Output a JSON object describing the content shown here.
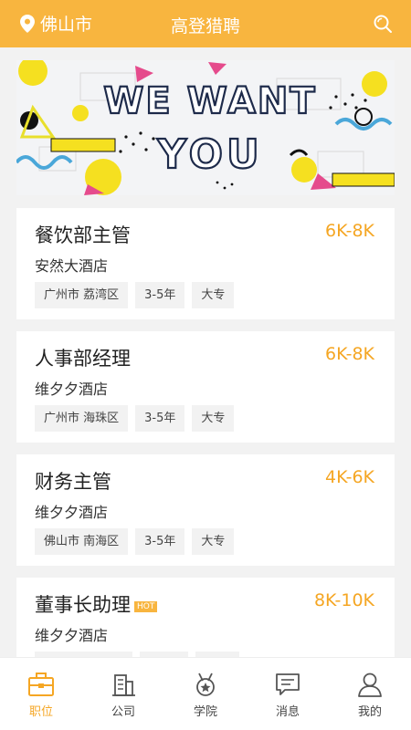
{
  "header": {
    "city": "佛山市",
    "title": "高登猎聘"
  },
  "banner": {
    "line1": "WE WANT",
    "line2": "YOU"
  },
  "jobs": [
    {
      "title": "餐饮部主管",
      "salary": "6K-8K",
      "company": "安然大酒店",
      "location": "广州市 荔湾区",
      "experience": "3-5年",
      "education": "大专",
      "hot": ""
    },
    {
      "title": "人事部经理",
      "salary": "6K-8K",
      "company": "维夕夕酒店",
      "location": "广州市 海珠区",
      "experience": "3-5年",
      "education": "大专",
      "hot": ""
    },
    {
      "title": "财务主管",
      "salary": "4K-6K",
      "company": "维夕夕酒店",
      "location": "佛山市 南海区",
      "experience": "3-5年",
      "education": "大专",
      "hot": ""
    },
    {
      "title": "董事长助理",
      "salary": "8K-10K",
      "company": "维夕夕酒店",
      "location": "",
      "experience": "",
      "education": "",
      "hot": "HOT"
    }
  ],
  "tabbar": {
    "items": [
      {
        "label": "职位",
        "icon": "briefcase-icon",
        "active": true
      },
      {
        "label": "公司",
        "icon": "building-icon",
        "active": false
      },
      {
        "label": "学院",
        "icon": "medal-icon",
        "active": false
      },
      {
        "label": "消息",
        "icon": "message-icon",
        "active": false
      },
      {
        "label": "我的",
        "icon": "user-icon",
        "active": false
      }
    ]
  },
  "colors": {
    "brand": "#f8b53f",
    "salary": "#f5a623"
  }
}
